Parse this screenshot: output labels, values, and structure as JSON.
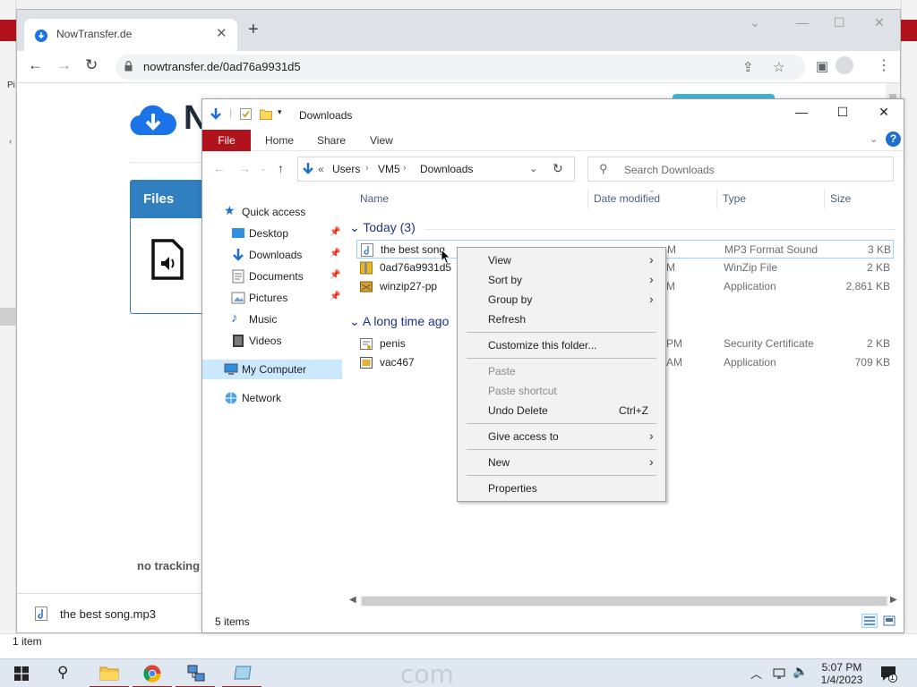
{
  "background": {
    "left_letters": "Pi",
    "status_items": "1 item"
  },
  "browser": {
    "tab_title": "NowTransfer.de",
    "url": "nowtransfer.de/0ad76a9931d5",
    "page": {
      "logo_letter": "N",
      "files_heading": "Files",
      "no_tracking": "no tracking",
      "download_file": "the best song.mp3"
    }
  },
  "explorer": {
    "title": "Downloads",
    "ribbon": {
      "file": "File",
      "tabs": [
        "Home",
        "Share",
        "View"
      ]
    },
    "breadcrumb": [
      "Users",
      "VM5",
      "Downloads"
    ],
    "breadcrumb_prefix": "«",
    "search_placeholder": "Search Downloads",
    "nav": [
      {
        "label": "Quick access",
        "icon": "star-icon"
      },
      {
        "label": "Desktop",
        "icon": "desktop-icon",
        "pinned": true
      },
      {
        "label": "Downloads",
        "icon": "download-icon",
        "pinned": true
      },
      {
        "label": "Documents",
        "icon": "documents-icon",
        "pinned": true
      },
      {
        "label": "Pictures",
        "icon": "pictures-icon",
        "pinned": true
      },
      {
        "label": "Music",
        "icon": "music-icon"
      },
      {
        "label": "Videos",
        "icon": "videos-icon"
      },
      {
        "label": "My Computer",
        "icon": "computer-icon",
        "selected": true
      },
      {
        "label": "Network",
        "icon": "network-icon"
      }
    ],
    "columns": [
      "Name",
      "Date modified",
      "Type",
      "Size"
    ],
    "groups": [
      {
        "label": "Today (3)",
        "files": [
          {
            "name": "the best song",
            "date": "M",
            "type": "MP3 Format Sound",
            "size": "3 KB"
          },
          {
            "name": "0ad76a9931d5",
            "date": "M",
            "type": "WinZip File",
            "size": "2 KB"
          },
          {
            "name": "winzip27-pp",
            "date": "M",
            "type": "Application",
            "size": "2,861 KB"
          }
        ]
      },
      {
        "label": "A long time ago",
        "files": [
          {
            "name": "penis",
            "date": "PM",
            "type": "Security Certificate",
            "size": "2 KB"
          },
          {
            "name": "vac467",
            "date": "AM",
            "type": "Application",
            "size": "709 KB"
          }
        ]
      }
    ],
    "status_count": "5 items"
  },
  "context_menu": {
    "items": [
      {
        "label": "View",
        "submenu": true
      },
      {
        "label": "Sort by",
        "submenu": true
      },
      {
        "label": "Group by",
        "submenu": true
      },
      {
        "label": "Refresh"
      },
      {
        "label": "Customize this folder..."
      },
      {
        "label": "Paste",
        "disabled": true
      },
      {
        "label": "Paste shortcut",
        "disabled": true
      },
      {
        "label": "Undo Delete",
        "shortcut": "Ctrl+Z"
      },
      {
        "label": "Give access to",
        "submenu": true
      },
      {
        "label": "New",
        "submenu": true
      },
      {
        "label": "Properties"
      }
    ]
  },
  "taskbar": {
    "faded_text": "com",
    "time": "5:07 PM",
    "date": "1/4/2023",
    "notification_count": "1"
  },
  "colors": {
    "accent_red": "#b1131c",
    "selection_blue": "#cce8ff",
    "files_blue": "#2f7fc1"
  }
}
